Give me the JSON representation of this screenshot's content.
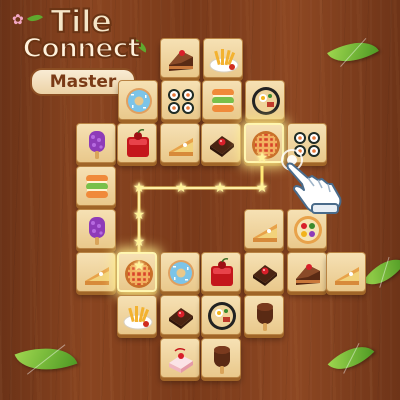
{
  "logo": {
    "line1": "Tile",
    "line2": "Connect",
    "line3": "Master"
  },
  "board": {
    "tiles": [
      {
        "icon": "cake-slice-chocolate-icon",
        "col": 0
      },
      {
        "icon": "fries-plate-icon",
        "col": 1
      },
      {
        "icon": "donut-icon",
        "col": 0
      },
      {
        "icon": "sushi-rolls-icon",
        "col": 1
      },
      {
        "icon": "macarons-icon",
        "col": 2
      },
      {
        "icon": "ramen-bowl-icon",
        "col": 3
      },
      {
        "icon": "popsicle-grape-icon",
        "col": 0
      },
      {
        "icon": "jelly-cherry-icon",
        "col": 1
      },
      {
        "icon": "pie-slice-icon",
        "col": 2
      },
      {
        "icon": "brownie-cherry-icon",
        "col": 3
      },
      {
        "icon": "lattice-pie-icon",
        "col": 4
      },
      {
        "icon": "sushi-rolls-icon",
        "col": 5
      },
      {
        "icon": "macarons-icon",
        "col": 0
      },
      {
        "icon": "popsicle-grape-icon",
        "col": 0
      },
      {
        "icon": "pie-slice-icon",
        "col": 5
      },
      {
        "icon": "fruit-tart-icon",
        "col": 6
      },
      {
        "icon": "pie-slice-icon",
        "col": 0
      },
      {
        "icon": "lattice-pie-icon",
        "col": 1
      },
      {
        "icon": "donut-icon",
        "col": 2
      },
      {
        "icon": "jelly-cherry-icon",
        "col": 3
      },
      {
        "icon": "brownie-cherry-icon",
        "col": 4
      },
      {
        "icon": "cake-slice-chocolate-icon",
        "col": 5
      },
      {
        "icon": "pie-slice-icon",
        "col": 6
      },
      {
        "icon": "fries-plate-icon",
        "col": 1
      },
      {
        "icon": "brownie-cherry-icon",
        "col": 2
      },
      {
        "icon": "ramen-bowl-icon",
        "col": 3
      },
      {
        "icon": "popsicle-chocolate-icon",
        "col": 4
      },
      {
        "icon": "cake-strawberry-icon",
        "col": 2
      },
      {
        "icon": "popsicle-chocolate-icon",
        "col": 3
      }
    ],
    "selected_pair": [
      "lattice-pie-icon",
      "lattice-pie-icon"
    ],
    "connection_path_stars": 8
  },
  "hint": {
    "icon": "pointing-hand-icon"
  },
  "colors": {
    "wood_background": "#7a3a1a",
    "tile_face": "#f0d49c",
    "highlight_glow": "#fff39a",
    "leaf_green": "#6cb330",
    "logo_text": "#f5e6c8"
  }
}
